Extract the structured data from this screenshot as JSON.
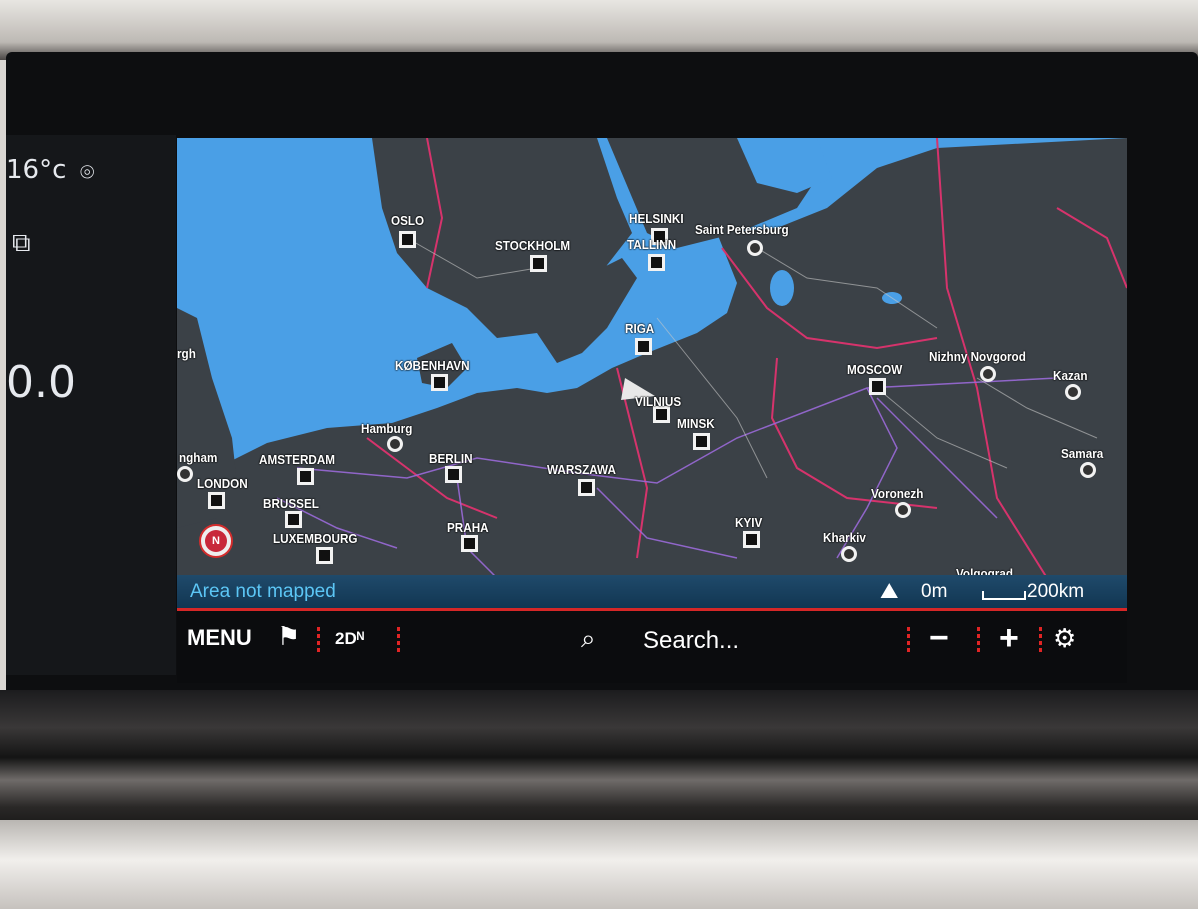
{
  "status_strip": {
    "temperature": "16°c",
    "speed": "0.0",
    "location_icon": "map-pin-icon",
    "media_icon": "media-source-icon"
  },
  "map": {
    "cities": [
      {
        "name": "OSLO",
        "marker": "square"
      },
      {
        "name": "STOCKHOLM",
        "marker": "square"
      },
      {
        "name": "HELSINKI",
        "marker": "square"
      },
      {
        "name": "TALLINN",
        "marker": "square"
      },
      {
        "name": "Saint Petersburg",
        "marker": "circle"
      },
      {
        "name": "RIGA",
        "marker": "square"
      },
      {
        "name": "KØBENHAVN",
        "marker": "square"
      },
      {
        "name": "VILNIUS",
        "marker": "square"
      },
      {
        "name": "MINSK",
        "marker": "square"
      },
      {
        "name": "MOSCOW",
        "marker": "square"
      },
      {
        "name": "Nizhny Novgorod",
        "marker": "circle"
      },
      {
        "name": "Kazan",
        "marker": "circle"
      },
      {
        "name": "Samara",
        "marker": "circle"
      },
      {
        "name": "Hamburg",
        "marker": "circle"
      },
      {
        "name": "AMSTERDAM",
        "marker": "square"
      },
      {
        "name": "BERLIN",
        "marker": "square"
      },
      {
        "name": "WARSZAWA",
        "marker": "square"
      },
      {
        "name": "LONDON",
        "marker": "square"
      },
      {
        "name": "BRUSSEL",
        "marker": "square"
      },
      {
        "name": "LUXEMBOURG",
        "marker": "square"
      },
      {
        "name": "PRAHA",
        "marker": "square"
      },
      {
        "name": "KYIV",
        "marker": "square"
      },
      {
        "name": "Kharkiv",
        "marker": "circle"
      },
      {
        "name": "Voronezh",
        "marker": "circle"
      },
      {
        "name": "Volgograd",
        "marker": "none"
      },
      {
        "name": "ngham",
        "marker": "circle"
      },
      {
        "name": "rgh",
        "marker": "none"
      }
    ],
    "compass_label": "N"
  },
  "status_bar": {
    "area_message": "Area not mapped",
    "elevation": "0m",
    "scale": "200km"
  },
  "toolbar": {
    "menu_label": "MENU",
    "view_label": "2Dᴺ",
    "search_placeholder": "Search...",
    "zoom_out_label": "−",
    "zoom_in_label": "+"
  },
  "colors": {
    "sea": "#4a9fe6",
    "land": "#3b4147",
    "border": "#d6336c",
    "road": "#9a6ad8",
    "status_bar_text": "#5cc6f5",
    "accent": "#e02424"
  }
}
